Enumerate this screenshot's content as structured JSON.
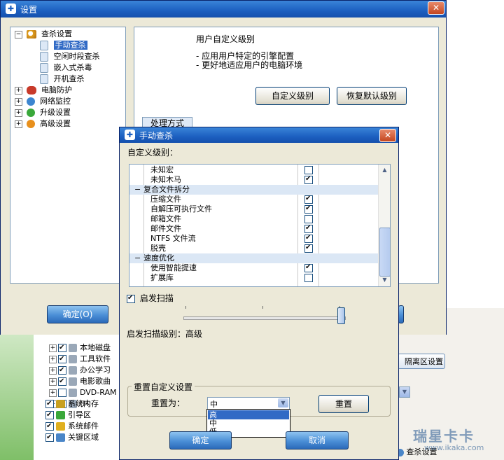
{
  "settings_window": {
    "title": "设置",
    "tree": {
      "root_label": "查杀设置",
      "children": [
        "手动查杀",
        "空闲时段查杀",
        "嵌入式杀毒",
        "开机查杀"
      ],
      "others": [
        "电脑防护",
        "网络监控",
        "升级设置",
        "高级设置"
      ]
    },
    "panel": {
      "heading": "用户自定义级别",
      "bullets": [
        "- 应用用户特定的引擎配置",
        "- 更好地适应用户的电脑环境"
      ],
      "custom_level_button": "自定义级别",
      "restore_default_button": "恢复默认级别",
      "section_tab": "处理方式"
    },
    "ok_button": "确定(O)"
  },
  "background_window": {
    "tree_items": [
      {
        "label": "本地磁盘",
        "checked": true
      },
      {
        "label": "工具软件",
        "checked": true
      },
      {
        "label": "办公学习",
        "checked": true
      },
      {
        "label": "电影歌曲",
        "checked": true
      },
      {
        "label": "DVD-RAM",
        "checked": false
      },
      {
        "label": "(H:",
        "checked": false
      }
    ],
    "bottom_items": [
      "系统内存",
      "引导区",
      "系统邮件",
      "关键区域"
    ],
    "isolation_button": "隔离区设置",
    "scan_settings": "查杀设置"
  },
  "dialog": {
    "title": "手动查杀",
    "custom_level_label": "自定义级别：",
    "list_rows": [
      {
        "label": "未知宏",
        "type": "item",
        "checked": false
      },
      {
        "label": "未知木马",
        "type": "item",
        "checked": true
      },
      {
        "label": "复合文件拆分",
        "type": "group"
      },
      {
        "label": "压缩文件",
        "type": "item",
        "checked": true
      },
      {
        "label": "自解压可执行文件",
        "type": "item",
        "checked": true
      },
      {
        "label": "邮箱文件",
        "type": "item",
        "checked": false
      },
      {
        "label": "邮件文件",
        "type": "item",
        "checked": true
      },
      {
        "label": "NTFS 文件流",
        "type": "item",
        "checked": true
      },
      {
        "label": "脱壳",
        "type": "item",
        "checked": true
      },
      {
        "label": "速度优化",
        "type": "group"
      },
      {
        "label": "使用智能提速",
        "type": "item",
        "checked": true
      },
      {
        "label": "扩展库",
        "type": "item",
        "checked": false
      }
    ],
    "heuristic_label": "启发扫描",
    "heuristic_checked": true,
    "heuristic_level_value": 1.0,
    "heuristic_level_text": "启发扫描级别：高级",
    "reset_group_title": "重置自定义设置",
    "reset_to_label": "重置为：",
    "reset_combo_value": "中",
    "reset_options": [
      "高",
      "中",
      "低"
    ],
    "reset_selected_index": 0,
    "reset_button": "重置",
    "ok_button": "确定",
    "cancel_button": "取消"
  },
  "watermark": {
    "brand": "瑞星卡卡",
    "url": "www.ikaka.com"
  }
}
